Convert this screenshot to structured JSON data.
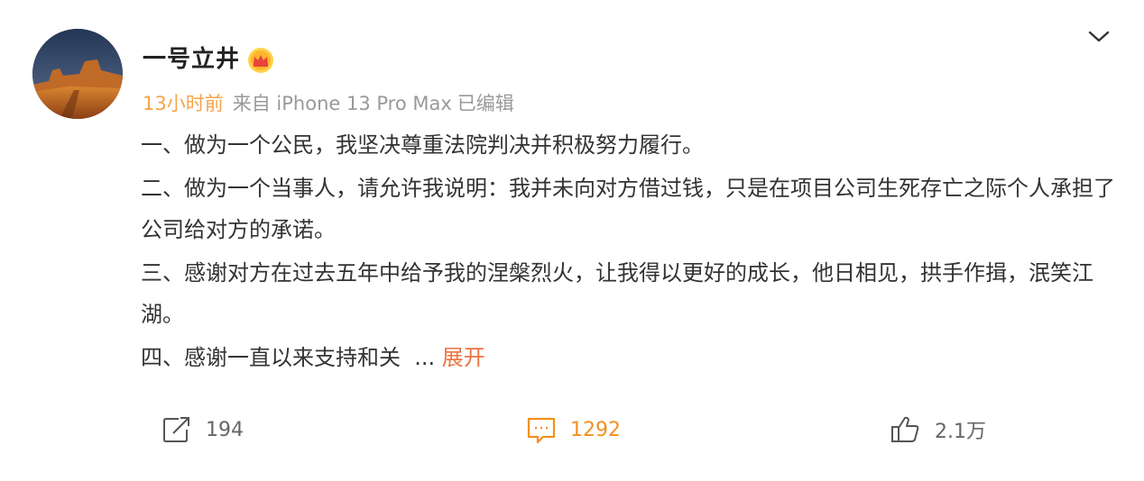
{
  "post": {
    "author": {
      "name": "一号立井",
      "badge_icon": "vip-crown-icon"
    },
    "meta": {
      "time": "13小时前",
      "source": "来自 iPhone 13 Pro Max",
      "edited": "已编辑"
    },
    "content": {
      "p1": "一、做为一个公民，我坚决尊重法院判决并积极努力履行。",
      "p2": "二、做为一个当事人，请允许我说明：我并未向对方借过钱，只是在项目公司生死存亡之际个人承担了公司给对方的承诺。",
      "p3": "三、感谢对方在过去五年中给予我的涅槃烈火，让我得以更好的成长，他日相见，拱手作揖，泯笑江湖。",
      "p4": "四、感谢一直以来支持和关",
      "ellipsis": "...",
      "expand_label": "展开"
    },
    "actions": {
      "repost_count": "194",
      "comment_count": "1292",
      "like_count": "2.1万"
    }
  },
  "colors": {
    "time_accent": "#f7a44a",
    "expand_link": "#eb7340",
    "comment_active": "#f2901f",
    "meta_gray": "#999999",
    "body_text": "#333333"
  },
  "icons": {
    "menu": "chevron-down-icon",
    "repost": "repost-icon",
    "comment": "comment-icon",
    "like": "thumbs-up-icon"
  }
}
